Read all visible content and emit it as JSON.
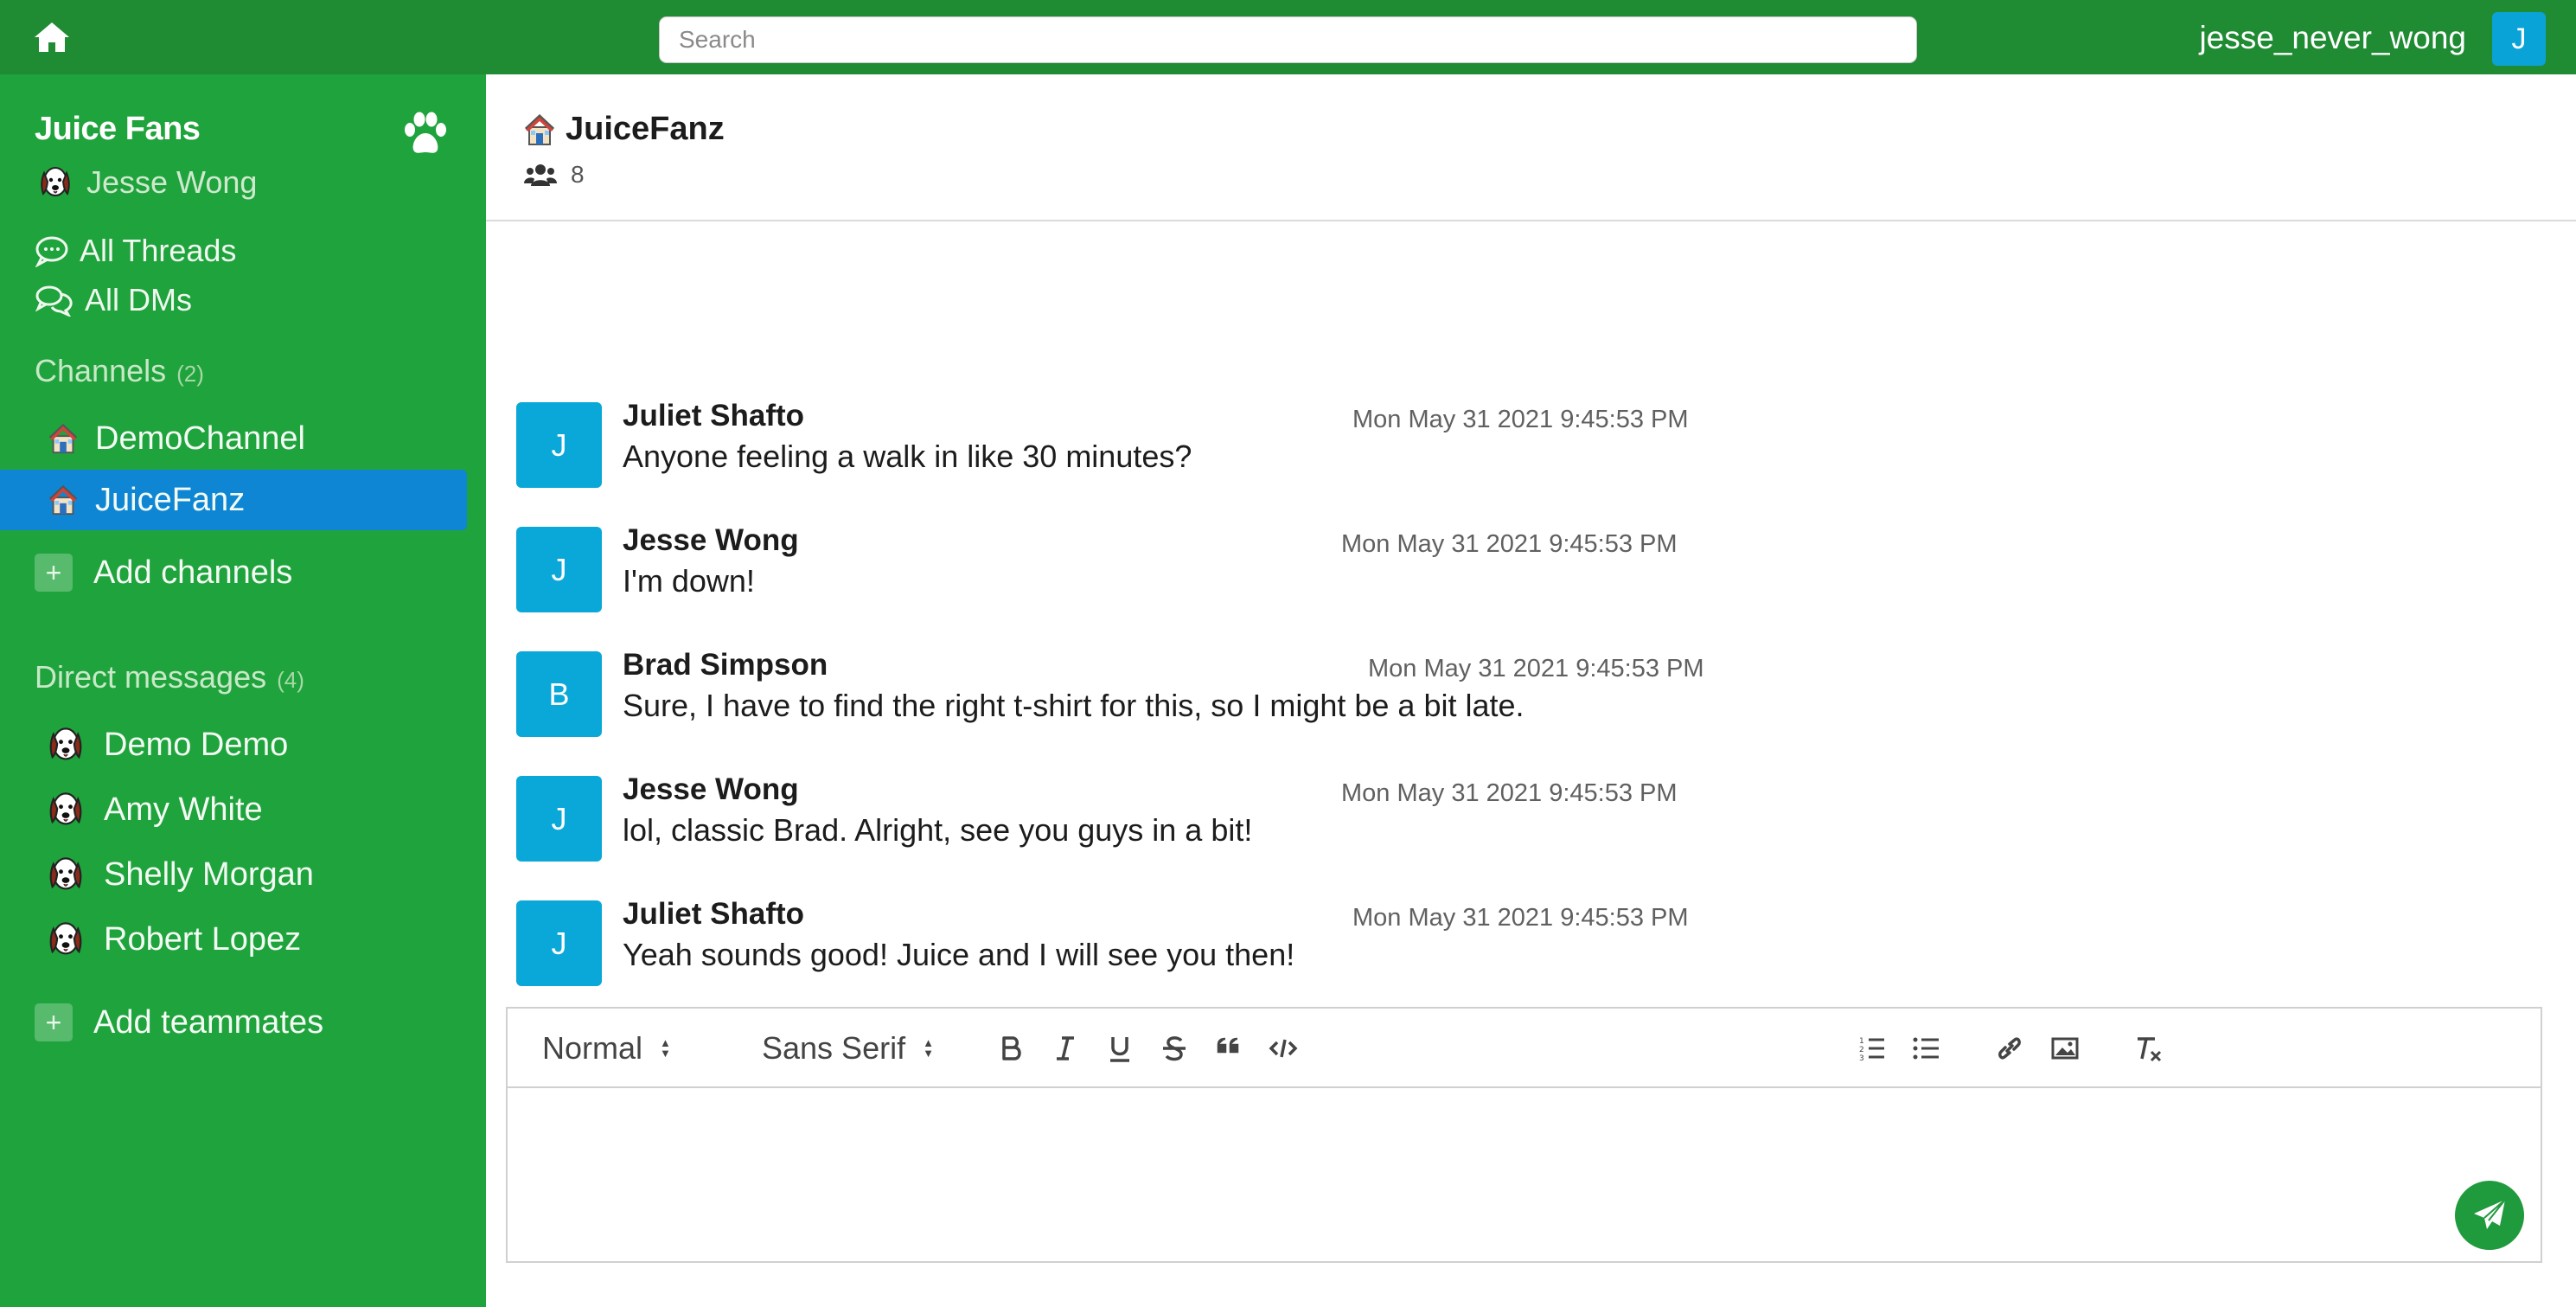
{
  "topbar": {
    "search_placeholder": "Search",
    "username": "jesse_never_wong",
    "avatar_initial": "J"
  },
  "sidebar": {
    "workspace_name": "Juice Fans",
    "current_user": "Jesse Wong",
    "nav": {
      "all_threads": "All Threads",
      "all_dms": "All DMs"
    },
    "channels_heading": "Channels",
    "channels_count": "(2)",
    "channels": [
      {
        "name": "DemoChannel",
        "active": false
      },
      {
        "name": "JuiceFanz",
        "active": true
      }
    ],
    "add_channels": "Add channels",
    "dm_heading": "Direct messages",
    "dm_count": "(4)",
    "dms": [
      {
        "name": "Demo Demo"
      },
      {
        "name": "Amy White"
      },
      {
        "name": "Shelly Morgan"
      },
      {
        "name": "Robert Lopez"
      }
    ],
    "add_teammates": "Add teammates"
  },
  "channel_header": {
    "title": "JuiceFanz",
    "member_count": "8"
  },
  "messages": [
    {
      "initial": "J",
      "author": "Juliet Shafto",
      "time": "Mon May 31 2021 9:45:53 PM",
      "text": "Anyone feeling a walk in like 30 minutes?"
    },
    {
      "initial": "J",
      "author": "Jesse Wong",
      "time": "Mon May 31 2021 9:45:53 PM",
      "text": "I'm down!"
    },
    {
      "initial": "B",
      "author": "Brad Simpson",
      "time": "Mon May 31 2021 9:45:53 PM",
      "text": "Sure, I have to find the right t-shirt for this, so I might be a bit late."
    },
    {
      "initial": "J",
      "author": "Jesse Wong",
      "time": "Mon May 31 2021 9:45:53 PM",
      "text": "lol, classic Brad. Alright, see you guys in a bit!"
    },
    {
      "initial": "J",
      "author": "Juliet Shafto",
      "time": "Mon May 31 2021 9:45:53 PM",
      "text": "Yeah sounds good! Juice and I will see you then!"
    }
  ],
  "editor": {
    "heading_picker": "Normal",
    "font_picker": "Sans Serif",
    "toolbar_icons": [
      "bold-icon",
      "italic-icon",
      "underline-icon",
      "strike-icon",
      "blockquote-icon",
      "code-block-icon",
      "ordered-list-icon",
      "bullet-list-icon",
      "link-icon",
      "image-icon",
      "clear-format-icon"
    ]
  },
  "colors": {
    "topbar": "#1f8b33",
    "sidebar": "#1fa33c",
    "active_channel": "#0e86d4",
    "avatar": "#0aa8d8",
    "send_button": "#1f9a3c"
  }
}
